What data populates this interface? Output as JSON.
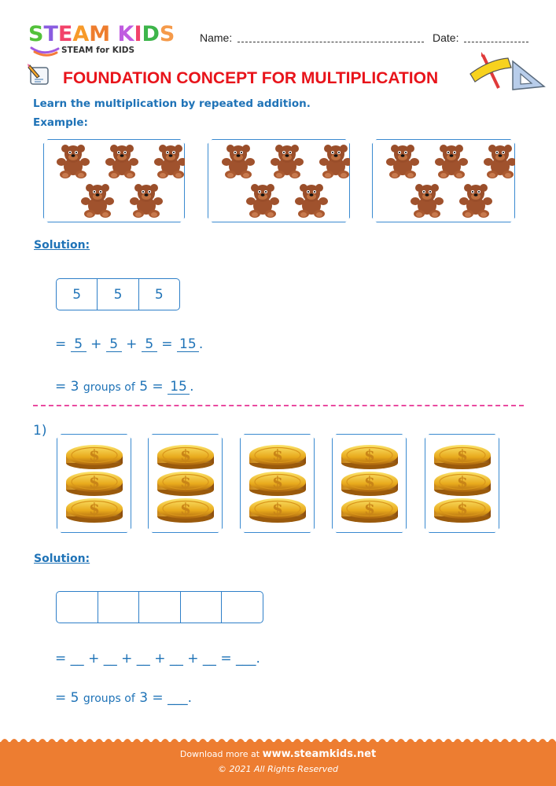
{
  "logo": {
    "letters": [
      {
        "ch": "S",
        "color": "#52C13A"
      },
      {
        "ch": "T",
        "color": "#8A5CE0"
      },
      {
        "ch": "E",
        "color": "#F2436A"
      },
      {
        "ch": "A",
        "color": "#F79A2A"
      },
      {
        "ch": "M",
        "color": "#EE7D2E"
      },
      {
        "ch": " ",
        "color": "#ffffff"
      },
      {
        "ch": "K",
        "color": "#C05BE0"
      },
      {
        "ch": "I",
        "color": "#F2436A"
      },
      {
        "ch": "D",
        "color": "#3DB54A"
      },
      {
        "ch": "S",
        "color": "#F59A4A"
      }
    ],
    "tagline": "STEAM for KIDS"
  },
  "header": {
    "name_label": "Name:",
    "date_label": "Date:"
  },
  "title": "FOUNDATION CONCEPT FOR MULTIPLICATION",
  "instruction": "Learn the multiplication by repeated addition.",
  "example_label": "Example:",
  "example": {
    "groups": 3,
    "items_per_group": 5,
    "item_icon": "teddy-bear-icon"
  },
  "example_solution": {
    "label": "Solution:",
    "cells": [
      "5",
      "5",
      "5"
    ],
    "addition": {
      "prefix": "=",
      "terms": [
        "5",
        "5",
        "5"
      ],
      "operator": "+",
      "equals": "=",
      "result": "15",
      "suffix": "."
    },
    "groups_line": {
      "prefix": "= 3",
      "middle": "groups of",
      "value": "5 =",
      "result": "15",
      "suffix": "."
    }
  },
  "question": {
    "number": "1)",
    "groups": 5,
    "items_per_group": 3,
    "item_icon": "gold-coin-icon",
    "solution": {
      "label": "Solution:",
      "cells": [
        "",
        "",
        "",
        "",
        ""
      ],
      "addition": {
        "prefix": "=",
        "terms": [
          "__",
          "__",
          "__",
          "__",
          "__"
        ],
        "operator": "+",
        "equals": "=",
        "result": "___",
        "suffix": "."
      },
      "groups_line": {
        "prefix": "= 5",
        "middle": "groups of",
        "value": "3 =",
        "result": "___",
        "suffix": "."
      }
    }
  },
  "footer": {
    "line1_prefix": "Download more at",
    "line1_link": "www.steamkids.net",
    "line2": "© 2021 All Rights Reserved"
  },
  "colors": {
    "title_red": "#E8141B",
    "text_blue": "#1F73B7",
    "frame_blue": "#3A8AD0",
    "divider_pink": "#E94AA0",
    "footer_orange": "#ED7D31"
  }
}
